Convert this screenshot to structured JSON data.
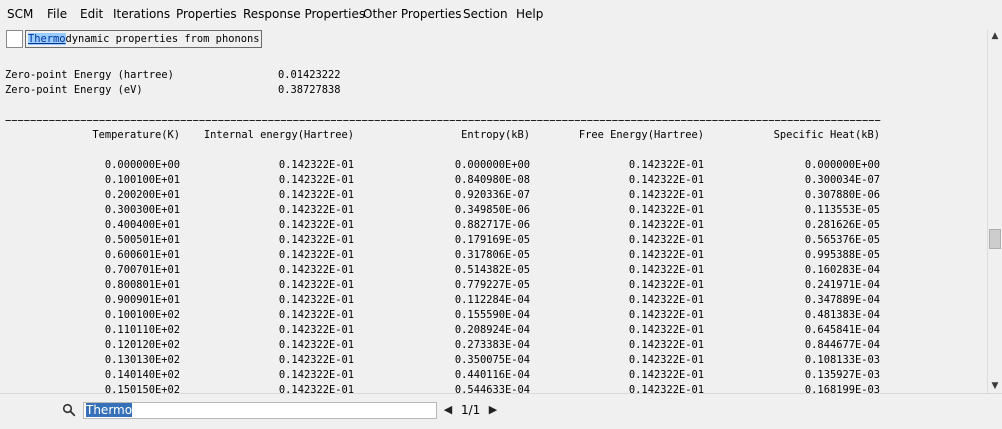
{
  "menubar": {
    "items": [
      "SCM",
      "File",
      "Edit",
      "Iterations",
      "Properties",
      "Response Properties",
      "Other Properties",
      "Section",
      "Help"
    ]
  },
  "section": {
    "title_match": "Thermo",
    "title_rest": "dynamic properties from phonons"
  },
  "zero_point": {
    "hartree_label": "Zero-point Energy (hartree)",
    "hartree_value": "0.01423222",
    "ev_label": "Zero-point Energy (eV)",
    "ev_value": "0.38727838"
  },
  "divider": "================================================================================================================================================",
  "table": {
    "headers": [
      "Temperature(K)",
      "Internal energy(Hartree)",
      "Entropy(kB)",
      "Free Energy(Hartree)",
      "Specific Heat(kB)"
    ],
    "rows": [
      [
        "0.000000E+00",
        "0.142322E-01",
        "0.000000E+00",
        "0.142322E-01",
        "0.000000E+00"
      ],
      [
        "0.100100E+01",
        "0.142322E-01",
        "0.840980E-08",
        "0.142322E-01",
        "0.300034E-07"
      ],
      [
        "0.200200E+01",
        "0.142322E-01",
        "0.920336E-07",
        "0.142322E-01",
        "0.307880E-06"
      ],
      [
        "0.300300E+01",
        "0.142322E-01",
        "0.349850E-06",
        "0.142322E-01",
        "0.113553E-05"
      ],
      [
        "0.400400E+01",
        "0.142322E-01",
        "0.882717E-06",
        "0.142322E-01",
        "0.281626E-05"
      ],
      [
        "0.500501E+01",
        "0.142322E-01",
        "0.179169E-05",
        "0.142322E-01",
        "0.565376E-05"
      ],
      [
        "0.600601E+01",
        "0.142322E-01",
        "0.317806E-05",
        "0.142322E-01",
        "0.995388E-05"
      ],
      [
        "0.700701E+01",
        "0.142322E-01",
        "0.514382E-05",
        "0.142322E-01",
        "0.160283E-04"
      ],
      [
        "0.800801E+01",
        "0.142322E-01",
        "0.779227E-05",
        "0.142322E-01",
        "0.241971E-04"
      ],
      [
        "0.900901E+01",
        "0.142322E-01",
        "0.112284E-04",
        "0.142322E-01",
        "0.347889E-04"
      ],
      [
        "0.100100E+02",
        "0.142322E-01",
        "0.155590E-04",
        "0.142322E-01",
        "0.481383E-04"
      ],
      [
        "0.110110E+02",
        "0.142322E-01",
        "0.208924E-04",
        "0.142322E-01",
        "0.645841E-04"
      ],
      [
        "0.120120E+02",
        "0.142322E-01",
        "0.273383E-04",
        "0.142322E-01",
        "0.844677E-04"
      ],
      [
        "0.130130E+02",
        "0.142322E-01",
        "0.350075E-04",
        "0.142322E-01",
        "0.108133E-03"
      ],
      [
        "0.140140E+02",
        "0.142322E-01",
        "0.440116E-04",
        "0.142322E-01",
        "0.135927E-03"
      ],
      [
        "0.150150E+02",
        "0.142322E-01",
        "0.544633E-04",
        "0.142322E-01",
        "0.168199E-03"
      ]
    ]
  },
  "search": {
    "value": "Thermo",
    "match_count": "1/1",
    "prev_glyph": "◀",
    "next_glyph": "▶",
    "icon": "search-icon"
  },
  "scrollbar": {
    "up_glyph": "▲",
    "down_glyph": "▼"
  },
  "colors": {
    "match_highlight": "#99ccff",
    "selection": "#3570b8"
  }
}
